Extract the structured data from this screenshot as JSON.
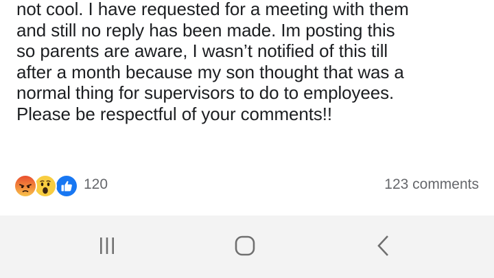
{
  "post": {
    "lines": [
      "not cool. I have requested for a meeting with them",
      "and still no reply has been made. Im posting this",
      "so parents are aware, I wasn’t notified of this till",
      "after a month because my son thought that was a",
      "normal thing for supervisors to do to employees.",
      "Please be respectful of your comments!!"
    ]
  },
  "reactions": {
    "icons": [
      "angry-reaction-icon",
      "wow-reaction-icon",
      "like-reaction-icon"
    ],
    "count": "120"
  },
  "comments": {
    "label": "123 comments"
  },
  "nav": {
    "icons": [
      "recent-apps-icon",
      "home-icon",
      "back-icon"
    ]
  },
  "colors": {
    "text": "#1c1e21",
    "meta_text": "#65676b",
    "like_blue": "#1877f2",
    "nav_bar_bg": "#f3f3f3",
    "nav_icon": "#6f6f6f"
  }
}
